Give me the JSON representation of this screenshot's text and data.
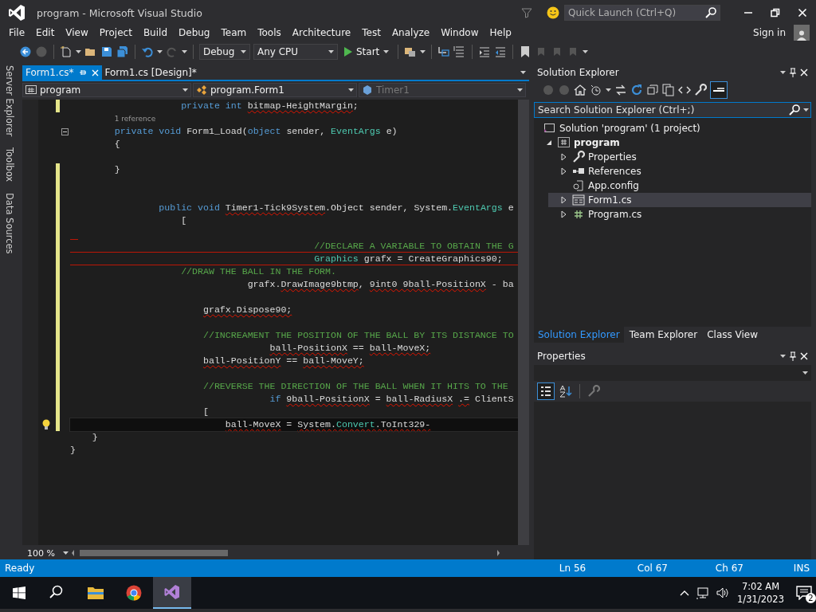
{
  "window": {
    "title": "program - Microsoft Visual Studio"
  },
  "quick_launch": {
    "placeholder": "Quick Launch (Ctrl+Q)"
  },
  "menu": [
    "File",
    "Edit",
    "View",
    "Project",
    "Build",
    "Debug",
    "Team",
    "Tools",
    "Architecture",
    "Test",
    "Analyze",
    "Window",
    "Help"
  ],
  "sign_in": "Sign in",
  "toolbar": {
    "configuration": "Debug",
    "platform": "Any CPU",
    "start": "Start"
  },
  "side_tabs": [
    "Server Explorer",
    "Toolbox",
    "Data Sources"
  ],
  "editor": {
    "tabs": [
      {
        "label": "Form1.cs*",
        "selected": true
      },
      {
        "label": "Form1.cs [Design]*",
        "selected": false
      }
    ],
    "nav": [
      {
        "text": "program",
        "kind": "project",
        "disabled": false
      },
      {
        "text": "program.Form1",
        "kind": "class",
        "disabled": false
      },
      {
        "text": "Timer1",
        "kind": "member",
        "disabled": true
      }
    ],
    "lines": [
      {
        "modified": true,
        "tokens": [
          {
            "kind": "kw",
            "text": "                    private int "
          },
          {
            "kind": "plain",
            "text": "bitmap-HeightMargin",
            "error": true
          },
          {
            "kind": "plain",
            "text": ";"
          }
        ]
      },
      {
        "modified": false,
        "tokens": [
          {
            "kind": "lens",
            "text": "        1 reference"
          }
        ]
      },
      {
        "modified": false,
        "fold": true,
        "tokens": [
          {
            "kind": "kw",
            "text": "        private void"
          },
          {
            "kind": "plain",
            "text": " Form1_Load("
          },
          {
            "kind": "kw",
            "text": "object"
          },
          {
            "kind": "plain",
            "text": " sender, "
          },
          {
            "kind": "type",
            "text": "EventArgs"
          },
          {
            "kind": "plain",
            "text": " e)"
          }
        ]
      },
      {
        "modified": false,
        "tokens": [
          {
            "kind": "plain",
            "text": "        {"
          }
        ]
      },
      {
        "modified": false
      },
      {
        "modified": true,
        "tokens": [
          {
            "kind": "plain",
            "text": "        }"
          }
        ]
      },
      {
        "modified": true
      },
      {
        "modified": true
      },
      {
        "modified": true,
        "tokens": [
          {
            "kind": "kw",
            "text": "                public void "
          },
          {
            "kind": "plain",
            "text": "Timer1-Tick9System",
            "error": true
          },
          {
            "kind": "plain",
            "text": ".Object sender, System."
          },
          {
            "kind": "type",
            "text": "EventArgs"
          },
          {
            "kind": "plain",
            "text": " e"
          }
        ]
      },
      {
        "modified": true,
        "tokens": [
          {
            "kind": "plain",
            "text": "                    ["
          }
        ]
      },
      {
        "modified": true,
        "error": true
      },
      {
        "modified": true,
        "error": true,
        "tokens": [
          {
            "kind": "comment",
            "text": "                                            //DECLARE A VARIABLE TO OBTAIN THE G"
          }
        ]
      },
      {
        "modified": true,
        "error": true,
        "tokens": [
          {
            "kind": "type",
            "text": "                                            Graphics"
          },
          {
            "kind": "plain",
            "text": " grafx = CreateGraphics90;"
          }
        ]
      },
      {
        "modified": true,
        "tokens": [
          {
            "kind": "comment",
            "text": "                    //DRAW THE BALL IN THE FORM."
          }
        ]
      },
      {
        "modified": true,
        "tokens": [
          {
            "kind": "plain",
            "text": "                                grafx."
          },
          {
            "kind": "plain",
            "text": "DrawImage9btmp",
            "error": true
          },
          {
            "kind": "plain",
            "text": ", "
          },
          {
            "kind": "plain",
            "text": "9int0 9ball-PositionX",
            "error": true
          },
          {
            "kind": "plain",
            "text": " - ba"
          }
        ]
      },
      {
        "modified": true
      },
      {
        "modified": true,
        "tokens": [
          {
            "kind": "plain",
            "text": "                        grafx.Dispose90;",
            "error": true
          }
        ]
      },
      {
        "modified": true
      },
      {
        "modified": true,
        "tokens": [
          {
            "kind": "comment",
            "text": "                        //INCREAMENT THE POSITION OF THE BALL BY ITS DISTANCE TO"
          }
        ]
      },
      {
        "modified": true,
        "tokens": [
          {
            "kind": "plain",
            "text": "                                    ball-PositionX",
            "error": true
          },
          {
            "kind": "plain",
            "text": " == "
          },
          {
            "kind": "plain",
            "text": "ball-MoveX;",
            "error": true
          }
        ]
      },
      {
        "modified": true,
        "tokens": [
          {
            "kind": "plain",
            "text": "                        ball-PositionY",
            "error": true
          },
          {
            "kind": "plain",
            "text": " == "
          },
          {
            "kind": "plain",
            "text": "ball-MoveY;",
            "error": true
          }
        ]
      },
      {
        "modified": true
      },
      {
        "modified": true,
        "tokens": [
          {
            "kind": "comment",
            "text": "                        //REVERSE THE DIRECTION OF THE BALL WHEN IT HITS TO THE"
          }
        ]
      },
      {
        "modified": true,
        "tokens": [
          {
            "kind": "kw",
            "text": "                                    if "
          },
          {
            "kind": "plain",
            "text": "9ball-PositionX",
            "error": true
          },
          {
            "kind": "plain",
            "text": " = "
          },
          {
            "kind": "plain",
            "text": "ball-RadiusX",
            "error": true
          },
          {
            "kind": "plain",
            "text": " .=",
            "error": true
          },
          {
            "kind": "plain",
            "text": " ClientS"
          }
        ]
      },
      {
        "modified": true,
        "tokens": [
          {
            "kind": "plain",
            "text": "                        ["
          }
        ]
      },
      {
        "modified": true,
        "current": true,
        "lightbulb": true,
        "tokens": [
          {
            "kind": "plain",
            "text": "                            ball-MoveX",
            "error": true
          },
          {
            "kind": "plain",
            "text": " = "
          },
          {
            "kind": "plain",
            "text": "System.",
            "error": true
          },
          {
            "kind": "type",
            "text": "Convert",
            "error": true
          },
          {
            "kind": "plain",
            "text": ".ToInt329-",
            "error": true
          }
        ]
      },
      {
        "modified": false,
        "tokens": [
          {
            "kind": "plain",
            "text": "    }"
          }
        ]
      },
      {
        "modified": false,
        "tokens": [
          {
            "kind": "plain",
            "text": "}"
          }
        ]
      }
    ],
    "zoom": "100 %"
  },
  "solution_explorer": {
    "title": "Solution Explorer",
    "search": {
      "placeholder": "Search Solution Explorer (Ctrl+;)"
    },
    "tree": [
      {
        "label": "Solution 'program' (1 project)",
        "kind": "solution",
        "selected": false,
        "bold": false,
        "children": [
          {
            "label": "program",
            "kind": "project",
            "expanded": true,
            "selected": false,
            "bold": true,
            "children": [
              {
                "label": "Properties",
                "kind": "properties",
                "expanded": false,
                "selected": false,
                "bold": false
              },
              {
                "label": "References",
                "kind": "references",
                "expanded": false,
                "selected": false,
                "bold": false
              },
              {
                "label": "App.config",
                "kind": "config",
                "selected": false,
                "bold": false
              },
              {
                "label": "Form1.cs",
                "kind": "form",
                "expanded": false,
                "selected": true,
                "bold": false
              },
              {
                "label": "Program.cs",
                "kind": "csharp",
                "expanded": false,
                "selected": false,
                "bold": false
              }
            ]
          }
        ]
      }
    ],
    "tabs": [
      {
        "label": "Solution Explorer",
        "selected": true
      },
      {
        "label": "Team Explorer",
        "selected": false
      },
      {
        "label": "Class View",
        "selected": false
      }
    ]
  },
  "properties": {
    "title": "Properties"
  },
  "status_bar": {
    "message": "Ready",
    "line": "Ln 56",
    "column": "Col 67",
    "char": "Ch 67",
    "mode": "INS"
  },
  "taskbar": {
    "apps": [
      {
        "kind": "search",
        "selected": false
      },
      {
        "kind": "files",
        "selected": false
      },
      {
        "kind": "browser",
        "selected": false
      },
      {
        "kind": "studio",
        "selected": true
      }
    ],
    "time": "7:02 AM",
    "date": "1/31/2023",
    "notifications": "2"
  }
}
